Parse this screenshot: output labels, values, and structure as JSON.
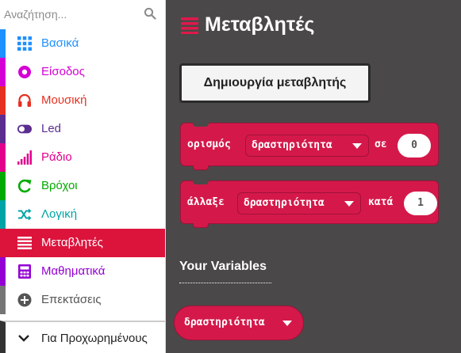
{
  "search": {
    "placeholder": "Αναζήτηση...",
    "icon": "search-icon"
  },
  "categories": [
    {
      "label": "Βασικά",
      "color": "#1e90ff",
      "icon": "grid-icon"
    },
    {
      "label": "Είσοδος",
      "color": "#d400d4",
      "icon": "circle-dot-icon"
    },
    {
      "label": "Μουσική",
      "color": "#e63022",
      "icon": "headphones-icon"
    },
    {
      "label": "Led",
      "color": "#5c2d91",
      "icon": "toggle-icon"
    },
    {
      "label": "Ράδιο",
      "color": "#e3008c",
      "icon": "signal-bars-icon"
    },
    {
      "label": "Βρόχοι",
      "color": "#00aa00",
      "icon": "refresh-icon"
    },
    {
      "label": "Λογική",
      "color": "#00a4a6",
      "icon": "shuffle-icon"
    },
    {
      "label": "Μεταβλητές",
      "color": "#dc143c",
      "icon": "list-icon",
      "selected": true
    },
    {
      "label": "Μαθηματικά",
      "color": "#9400d3",
      "icon": "calculator-icon"
    },
    {
      "label": "Επεκτάσεις",
      "color": "#757575",
      "icon": "plus-circle-icon"
    }
  ],
  "advanced": {
    "label": "Για Προχωρημένους",
    "icon": "chevron-down-icon"
  },
  "main": {
    "title": "Μεταβλητές",
    "title_icon": "list-icon",
    "create_button": "Δημιουργία μεταβλητής",
    "blocks": {
      "set": {
        "keyword": "ορισμός",
        "variable": "δραστηριότητα",
        "connector": "σε",
        "value": "0"
      },
      "change": {
        "keyword": "άλλαξε",
        "variable": "δραστηριότητα",
        "connector": "κατά",
        "value": "1"
      }
    },
    "your_variables": "Your Variables",
    "variables": [
      "δραστηριότητα"
    ]
  },
  "colors": {
    "workspace_bg": "#4a4848",
    "block": "#d4194a",
    "block_border": "#a1113a"
  }
}
